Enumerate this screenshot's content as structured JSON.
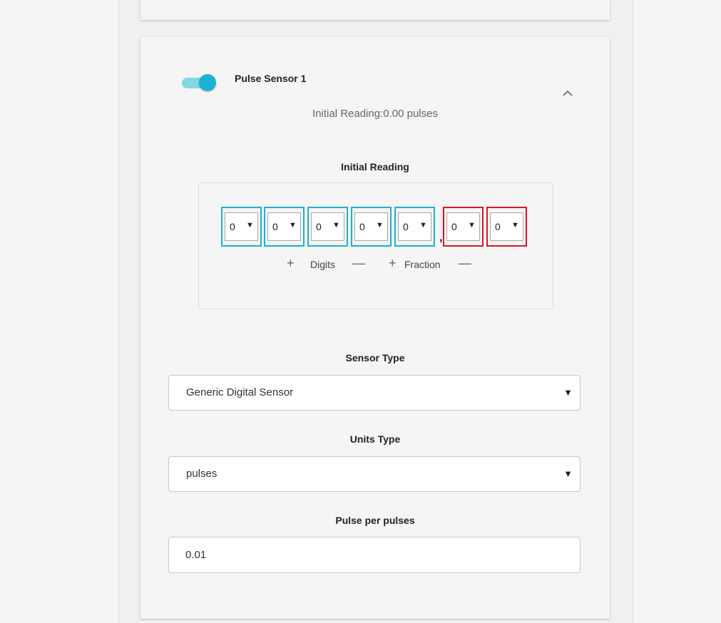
{
  "sensor": {
    "title": "Pulse Sensor 1",
    "enabled": true,
    "expanded": true,
    "summary": "Initial Reading:0.00 pulses"
  },
  "initial_reading": {
    "label": "Initial Reading",
    "digits": [
      "0",
      "0",
      "0",
      "0",
      "0"
    ],
    "decimal_separator": ",",
    "fraction": [
      "0",
      "0"
    ],
    "digits_label": "Digits",
    "fraction_label": "Fraction",
    "plus_symbol": "+",
    "minus_symbol": "—",
    "dropdown_symbol": "▼"
  },
  "sensor_type": {
    "label": "Sensor Type",
    "value": "Generic Digital Sensor"
  },
  "units_type": {
    "label": "Units Type",
    "value": "pulses"
  },
  "pulse_per": {
    "label": "Pulse per pulses",
    "value": "0.01"
  },
  "colors": {
    "accent": "#1ab1d2",
    "toggle_track": "#80d8e4",
    "fraction_border": "#e0141e"
  }
}
